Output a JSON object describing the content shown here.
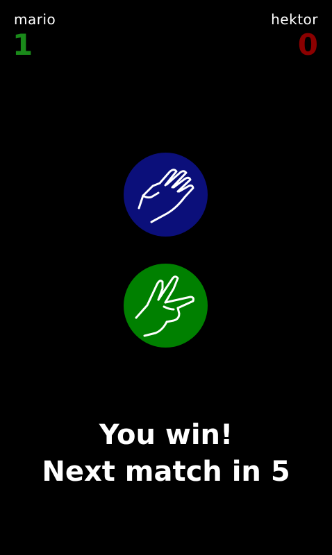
{
  "players": {
    "left": {
      "name": "mario",
      "score": "1",
      "score_color": "#1a8a1a"
    },
    "right": {
      "name": "hektor",
      "score": "0",
      "score_color": "#8b0000"
    }
  },
  "moves": {
    "opponent": {
      "icon": "paper-hand-icon",
      "color": "#0b0f7a"
    },
    "player": {
      "icon": "scissors-hand-icon",
      "color": "#008000"
    }
  },
  "result": {
    "headline": "You win!",
    "countdown": "Next match in 5"
  }
}
